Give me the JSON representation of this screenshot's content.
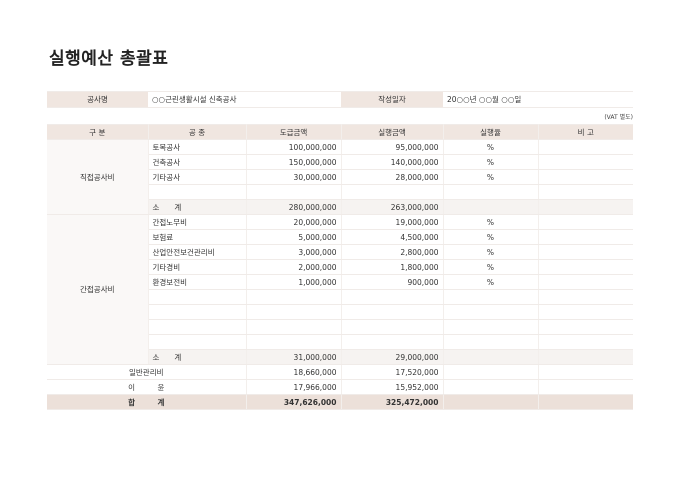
{
  "title": "실행예산 총괄표",
  "info": {
    "project_label": "공사명",
    "project_value": "○○근린생활시설 신축공사",
    "date_label": "작성일자",
    "date_value": "20○○년 ○○월 ○○일"
  },
  "vat_note": "(VAT 별도)",
  "headers": [
    "구 분",
    "공 종",
    "도급금액",
    "실행금액",
    "실행율",
    "비 고"
  ],
  "direct": {
    "group": "직접공사비",
    "rows": [
      {
        "name": "토목공사",
        "contract": "100,000,000",
        "exec": "95,000,000",
        "rate": "%"
      },
      {
        "name": "건축공사",
        "contract": "150,000,000",
        "exec": "140,000,000",
        "rate": "%"
      },
      {
        "name": "기타공사",
        "contract": "30,000,000",
        "exec": "28,000,000",
        "rate": "%"
      },
      {
        "name": "",
        "contract": "",
        "exec": "",
        "rate": ""
      }
    ],
    "subtotal": {
      "label": "소　　계",
      "contract": "280,000,000",
      "exec": "263,000,000"
    }
  },
  "indirect": {
    "group": "간접공사비",
    "rows": [
      {
        "name": "간접노무비",
        "contract": "20,000,000",
        "exec": "19,000,000",
        "rate": "%"
      },
      {
        "name": "보험료",
        "contract": "5,000,000",
        "exec": "4,500,000",
        "rate": "%"
      },
      {
        "name": "산업안전보건관리비",
        "contract": "3,000,000",
        "exec": "2,800,000",
        "rate": "%"
      },
      {
        "name": "기타경비",
        "contract": "2,000,000",
        "exec": "1,800,000",
        "rate": "%"
      },
      {
        "name": "환경보전비",
        "contract": "1,000,000",
        "exec": "900,000",
        "rate": "%"
      },
      {
        "name": "",
        "contract": "",
        "exec": "",
        "rate": ""
      },
      {
        "name": "",
        "contract": "",
        "exec": "",
        "rate": ""
      },
      {
        "name": "",
        "contract": "",
        "exec": "",
        "rate": ""
      },
      {
        "name": "",
        "contract": "",
        "exec": "",
        "rate": ""
      }
    ],
    "subtotal": {
      "label": "소　　계",
      "contract": "31,000,000",
      "exec": "29,000,000"
    }
  },
  "general": {
    "label": "일반관리비",
    "contract": "18,660,000",
    "exec": "17,520,000"
  },
  "profit": {
    "label": "이　　　윤",
    "contract": "17,966,000",
    "exec": "15,952,000"
  },
  "total": {
    "label": "합　　　계",
    "contract": "347,626,000",
    "exec": "325,472,000"
  }
}
